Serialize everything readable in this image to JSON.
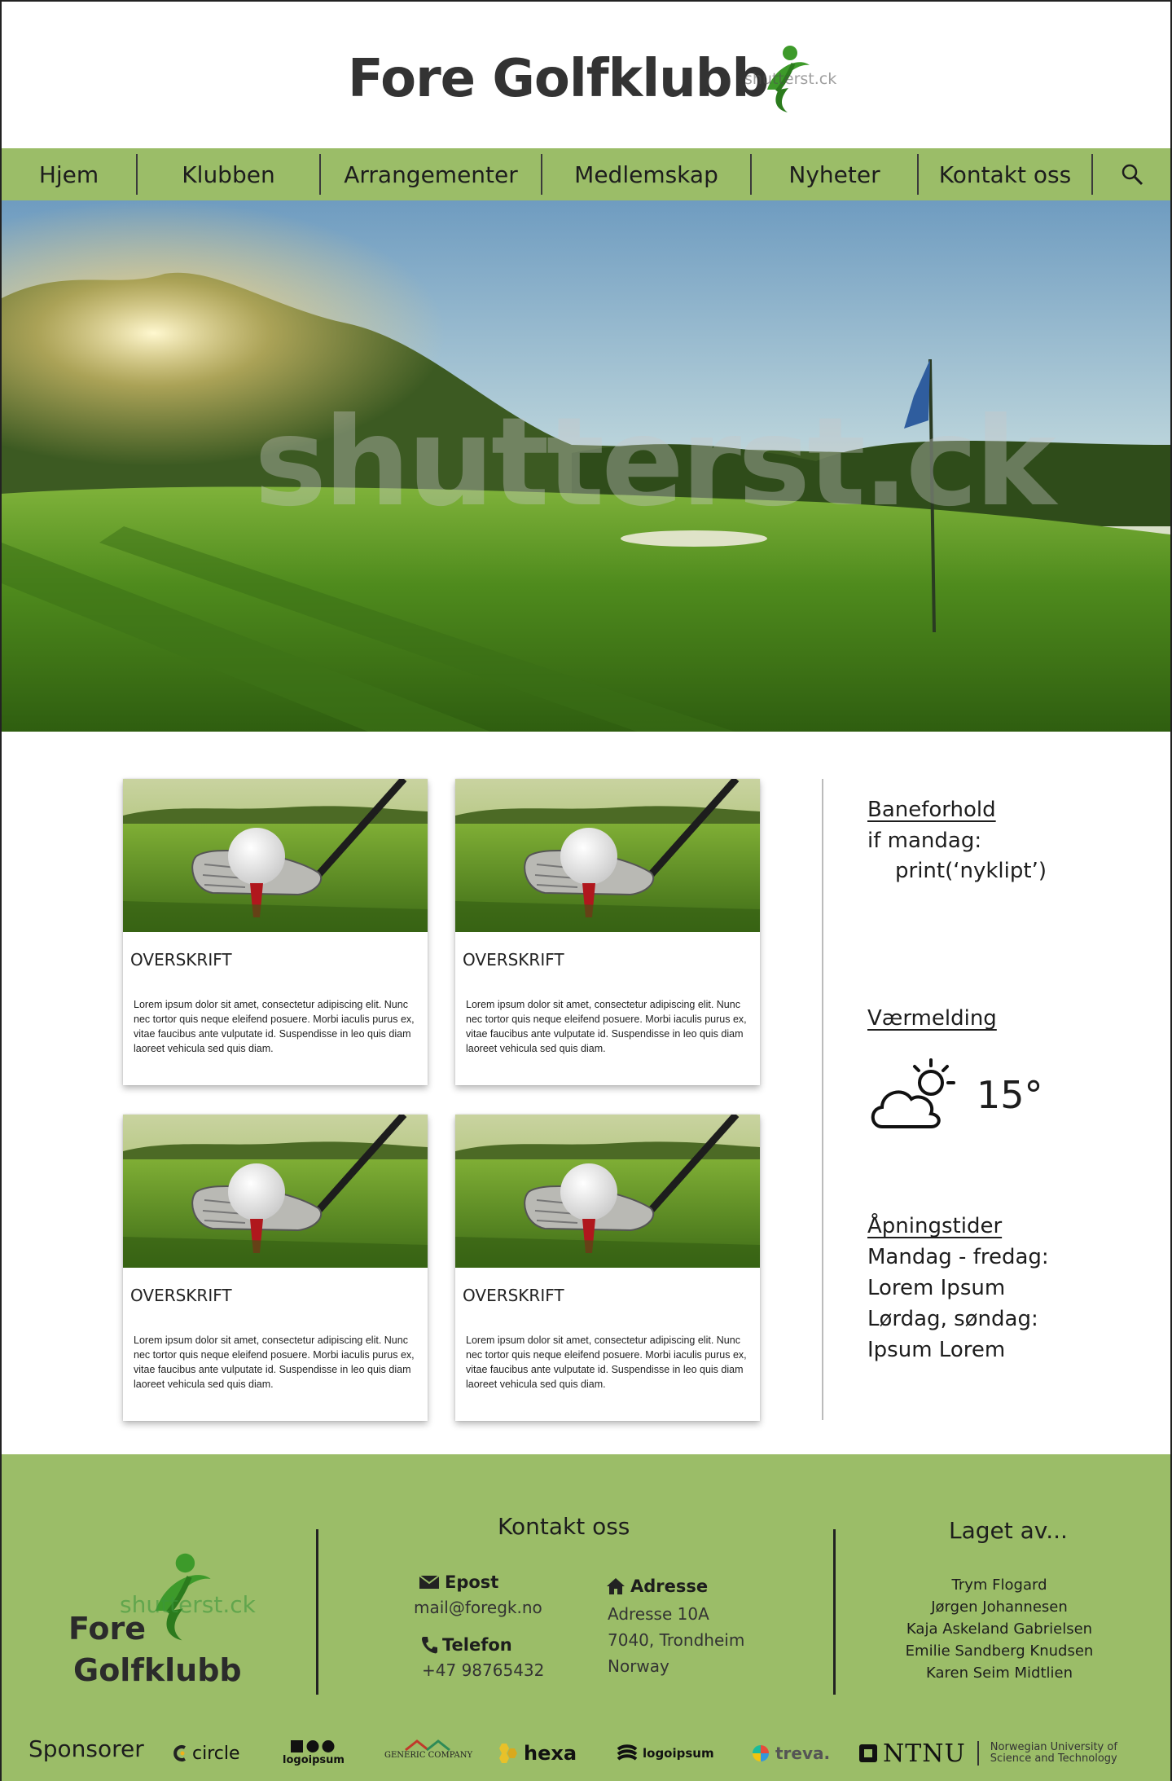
{
  "header": {
    "title": "Fore Golfklubb",
    "watermark": "shutterst.ck"
  },
  "nav": {
    "items": [
      {
        "label": "Hjem"
      },
      {
        "label": "Klubben"
      },
      {
        "label": "Arrangementer"
      },
      {
        "label": "Medlemskap"
      },
      {
        "label": "Nyheter"
      },
      {
        "label": "Kontakt oss"
      }
    ],
    "search_icon": "search-icon"
  },
  "hero": {
    "watermark": "shutterst.ck"
  },
  "cards": [
    {
      "title": "OVERSKRIFT",
      "text": "Lorem ipsum dolor sit amet, consectetur adipiscing elit. Nunc nec tortor quis neque eleifend posuere. Morbi iaculis purus ex, vitae faucibus ante vulputate id. Suspendisse in leo quis diam laoreet vehicula sed quis diam."
    },
    {
      "title": "OVERSKRIFT",
      "text": "Lorem ipsum dolor sit amet, consectetur adipiscing elit. Nunc nec tortor quis neque eleifend posuere. Morbi iaculis purus ex, vitae faucibus ante vulputate id. Suspendisse in leo quis diam laoreet vehicula sed quis diam."
    },
    {
      "title": "OVERSKRIFT",
      "text": "Lorem ipsum dolor sit amet, consectetur adipiscing elit. Nunc nec tortor quis neque eleifend posuere. Morbi iaculis purus ex, vitae faucibus ante vulputate id. Suspendisse in leo quis diam laoreet vehicula sed quis diam."
    },
    {
      "title": "OVERSKRIFT",
      "text": "Lorem ipsum dolor sit amet, consectetur adipiscing elit. Nunc nec tortor quis neque eleifend posuere. Morbi iaculis purus ex, vitae faucibus ante vulputate id. Suspendisse in leo quis diam laoreet vehicula sed quis diam."
    }
  ],
  "sidebar": {
    "course": {
      "heading": "Baneforhold",
      "line1": "if mandag:",
      "line2": "print(‘nyklipt’)"
    },
    "weather": {
      "heading": "Værmelding",
      "icon": "partly-cloudy-icon",
      "temperature": "15°"
    },
    "hours": {
      "heading": "Åpningstider",
      "lines": [
        "Mandag - fredag:",
        "Lorem Ipsum",
        "Lørdag, søndag:",
        "Ipsum Lorem"
      ]
    }
  },
  "footer": {
    "logo": {
      "line1": "Fore",
      "line2": "Golfklubb",
      "watermark": "shutterst.ck"
    },
    "contact": {
      "heading": "Kontakt oss",
      "email_label": "Epost",
      "email": "mail@foregk.no",
      "phone_label": "Telefon",
      "phone": "+47 98765432",
      "address_label": "Adresse",
      "address_lines": [
        "Adresse 10A",
        "7040, Trondheim",
        "Norway"
      ]
    },
    "credits": {
      "heading": "Laget av...",
      "names": [
        "Trym Flogard",
        "Jørgen Johannesen",
        "Kaja Askeland Gabrielsen",
        "Emilie Sandberg Knudsen",
        "Karen Seim Midtlien"
      ]
    },
    "sponsors": {
      "label": "Sponsorer",
      "items": [
        "circle",
        "logoipsum",
        "GENERIC COMPANY",
        "hexa",
        "logoipsum",
        "treva.",
        "NTNU"
      ],
      "ntnu_sub1": "Norwegian University of",
      "ntnu_sub2": "Science and Technology"
    }
  },
  "colors": {
    "accent_green": "#9bbd68",
    "logo_green": "#3d9a2a"
  }
}
